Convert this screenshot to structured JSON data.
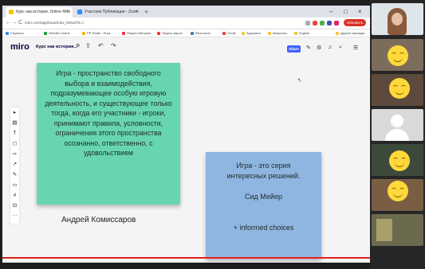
{
  "browser": {
    "tabs": [
      {
        "label": "Курс нак история. Online Miro",
        "close": "×"
      },
      {
        "label": "Участник Публикации - Zoom",
        "close": "×"
      }
    ],
    "new_tab": "+",
    "window_controls": {
      "minimize": "–",
      "maximize": "□",
      "close": "×"
    },
    "nav": {
      "back": "←",
      "forward": "→",
      "reload": "C"
    },
    "url": "miro.com/app/board/o9J_kWLEFE=/",
    "update_button": "Обновить",
    "bookmarks": [
      "Сервисы",
      "SberBiz Online",
      "PR Retail - Игра...",
      "Яндекс.Метрика",
      "Яндекс.Карты",
      "ВКонтакте",
      "Gmail",
      "Здоровье",
      "Кварталы",
      "English",
      "Другие закладки"
    ]
  },
  "miro": {
    "logo": "miro",
    "board_name": "Курс нак история...",
    "share_label": "Share",
    "toolbar_more": "···"
  },
  "board": {
    "sticky_green_text": "Игра - пространство свободного выбора и взаимодействия, подразумевающее особую игровую деятельность, и существующее только тогда, когда его участники - игроки, принимают правила, условности, ограничения этого пространства осознанно, ответственно, с удовольствием",
    "author": "Андрей Комиссаров",
    "sticky_blue_lines": [
      "Игра - это серия",
      "интересных решений.",
      "",
      "Сид Мейер",
      "",
      "",
      "+ informed choices"
    ]
  },
  "colors": {
    "sticky_green": "#67d6ae",
    "sticky_blue": "#8fb6e0",
    "miro_share": "#4262ff",
    "progress": "#e02020"
  }
}
